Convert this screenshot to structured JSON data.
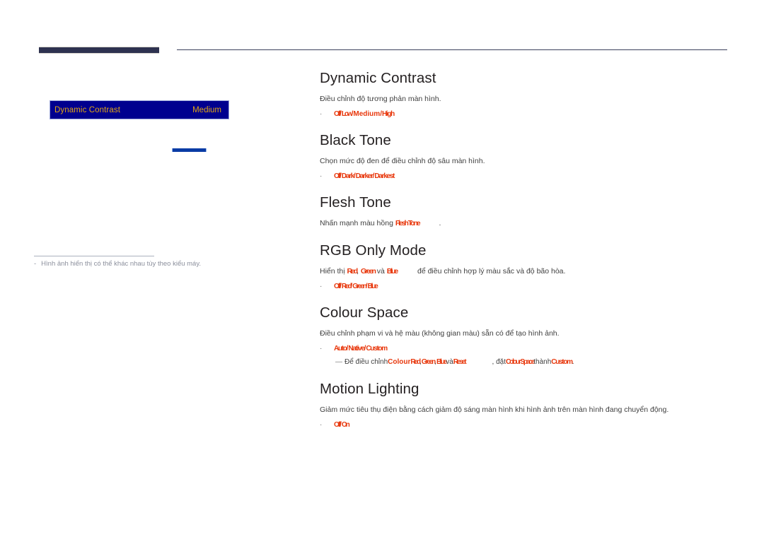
{
  "page": {
    "language": "vi",
    "accent_navy": "#2e3250",
    "osd_bg": "#00008f",
    "osd_text": "#e0a415",
    "option_red": "#e8380d",
    "note_gray": "#8b8f9c"
  },
  "osd": {
    "menu_label": "Dynamic Contrast",
    "menu_value": "Medium",
    "scrollbar_name": "osd-scrollbar"
  },
  "left_note": {
    "dash": "-",
    "text": "Hình ảnh hiển thị có thể khác nhau tùy theo kiểu máy."
  },
  "sections": [
    {
      "id": "dynamic-contrast",
      "title": "Dynamic Contrast",
      "body": "Điều chỉnh độ tương phản màn hình.",
      "bullet": "·",
      "options": [
        "Off",
        " / ",
        "Low",
        " / ",
        "Medium",
        " / ",
        "High"
      ],
      "options_plain": "Off / Low / Medium / High"
    },
    {
      "id": "black-tone",
      "title": "Black Tone",
      "body": "Chọn mức độ đen để điều chỉnh độ sâu màn hình.",
      "bullet": "·",
      "options": [
        "Off",
        " / ",
        "Dark",
        " / ",
        "Darker",
        " / ",
        "Darkest"
      ],
      "options_plain": "Off / Dark / Darker / Darkest"
    },
    {
      "id": "flesh-tone",
      "title": "Flesh Tone",
      "body_pre": "Nhấn mạnh màu hồng ",
      "body_red": "Flesh Tone",
      "body_post": "."
    },
    {
      "id": "rgb-only-mode",
      "title": "RGB Only Mode",
      "body_pre": "Hiển thị ",
      "body_red_1": "Red",
      "body_mid_1": ", ",
      "body_red_2": "Green",
      "body_mid_2": " và ",
      "body_red_3": "Blue",
      "body_post": " để điều chỉnh hợp lý màu sắc và độ bão hòa.",
      "bullet": "·",
      "options": [
        "Off",
        " / ",
        "Red",
        " / ",
        "Green",
        " / ",
        "Blue"
      ],
      "options_plain": "Off / Red / Green / Blue"
    },
    {
      "id": "colour-space",
      "title": "Colour Space",
      "body": "Điều chỉnh phạm vi và hệ màu (không gian màu) sẵn có để tạo hình ảnh.",
      "bullet": "·",
      "options": [
        "Auto",
        " / ",
        "Native",
        " / ",
        "Custom"
      ],
      "options_plain": "Auto / Native / Custom",
      "subnote": {
        "emdash": "—",
        "pre": "Để điều chỉnh ",
        "red_1": "Colour",
        "sp_1": " ",
        "red_2": "Red",
        "mid_1": ", ",
        "red_3": "Green",
        "mid_2": ", ",
        "red_4": "Blue",
        "mid_3": " và ",
        "red_5": "Reset",
        "mid_4": ", đặt ",
        "red_6": "Colour Space",
        "mid_5": " thành ",
        "red_7": "Custom",
        "post": "."
      }
    },
    {
      "id": "motion-lighting",
      "title": "Motion Lighting",
      "body": "Giảm mức tiêu thụ điện bằng cách giảm độ sáng màn hình khi hình ảnh trên màn hình đang chuyển động.",
      "bullet": "·",
      "options": [
        "Off",
        " / ",
        "On"
      ],
      "options_plain": "Off / On"
    }
  ]
}
